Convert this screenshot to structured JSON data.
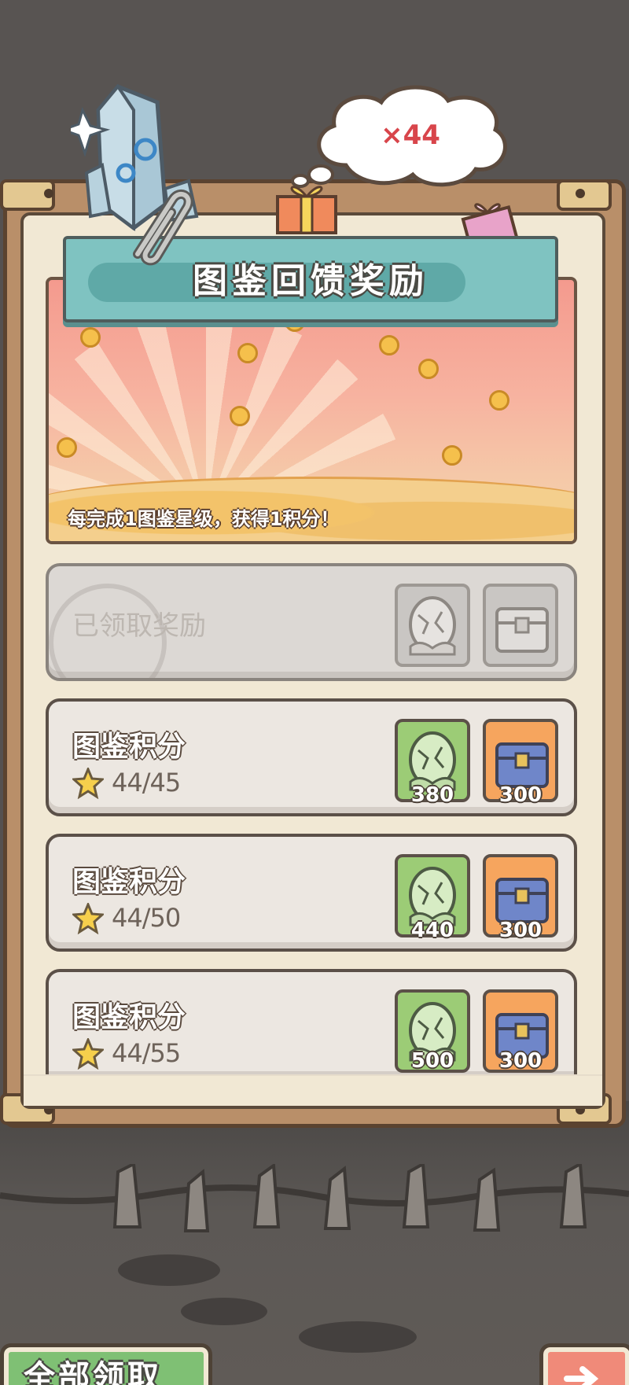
{
  "title": "图鉴回馈奖励",
  "banner": {
    "multiplier": "×44",
    "caption": "每完成1图鉴星级，获得1积分！"
  },
  "claimed_row": {
    "label": "已领取奖励"
  },
  "rows": [
    {
      "title": "图鉴积分",
      "progress": "44/45",
      "egg_count": "380",
      "chest_count": "300"
    },
    {
      "title": "图鉴积分",
      "progress": "44/50",
      "egg_count": "440",
      "chest_count": "300"
    },
    {
      "title": "图鉴积分",
      "progress": "44/55",
      "egg_count": "500",
      "chest_count": "300"
    }
  ],
  "buttons": {
    "claim_all": "全部领取"
  },
  "icons": {
    "star": "star-icon",
    "egg": "egg-icon",
    "chest": "chest-icon",
    "crystal": "crystal-icon",
    "clip": "paperclip-icon",
    "gift": "gift-icon",
    "exit": "exit-icon"
  },
  "colors": {
    "title_plate": "#7fc3c1",
    "egg_tile": "#9ccc76",
    "chest_tile": "#f6a55e",
    "multiplier": "#d8454b",
    "claim_button": "#7fc074"
  }
}
